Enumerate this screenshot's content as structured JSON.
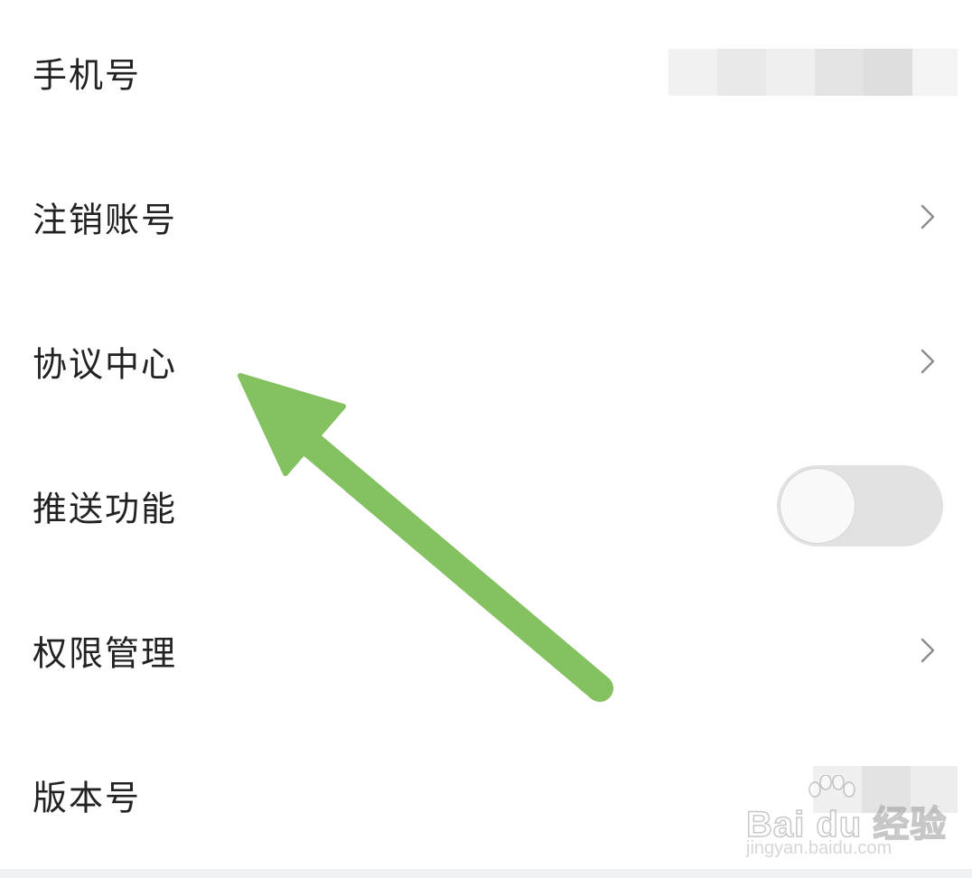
{
  "settings": {
    "items": [
      {
        "label": "手机号",
        "control": "value"
      },
      {
        "label": "注销账号",
        "control": "chevron"
      },
      {
        "label": "协议中心",
        "control": "chevron"
      },
      {
        "label": "推送功能",
        "control": "toggle",
        "toggle_on": false
      },
      {
        "label": "权限管理",
        "control": "chevron"
      },
      {
        "label": "版本号",
        "control": "value"
      }
    ]
  },
  "icons": {
    "chevron": "chevron-right-icon",
    "annotation": "green-arrow-icon"
  },
  "colors": {
    "annotation_arrow": "#84c160",
    "toggle_track": "#e2e2e2",
    "toggle_knob": "#f9f9f9",
    "chevron": "#8c8c8c",
    "label_text": "#222222"
  },
  "watermark": {
    "brand": "Bai du 经验",
    "url": "jingyan.baidu.com"
  }
}
